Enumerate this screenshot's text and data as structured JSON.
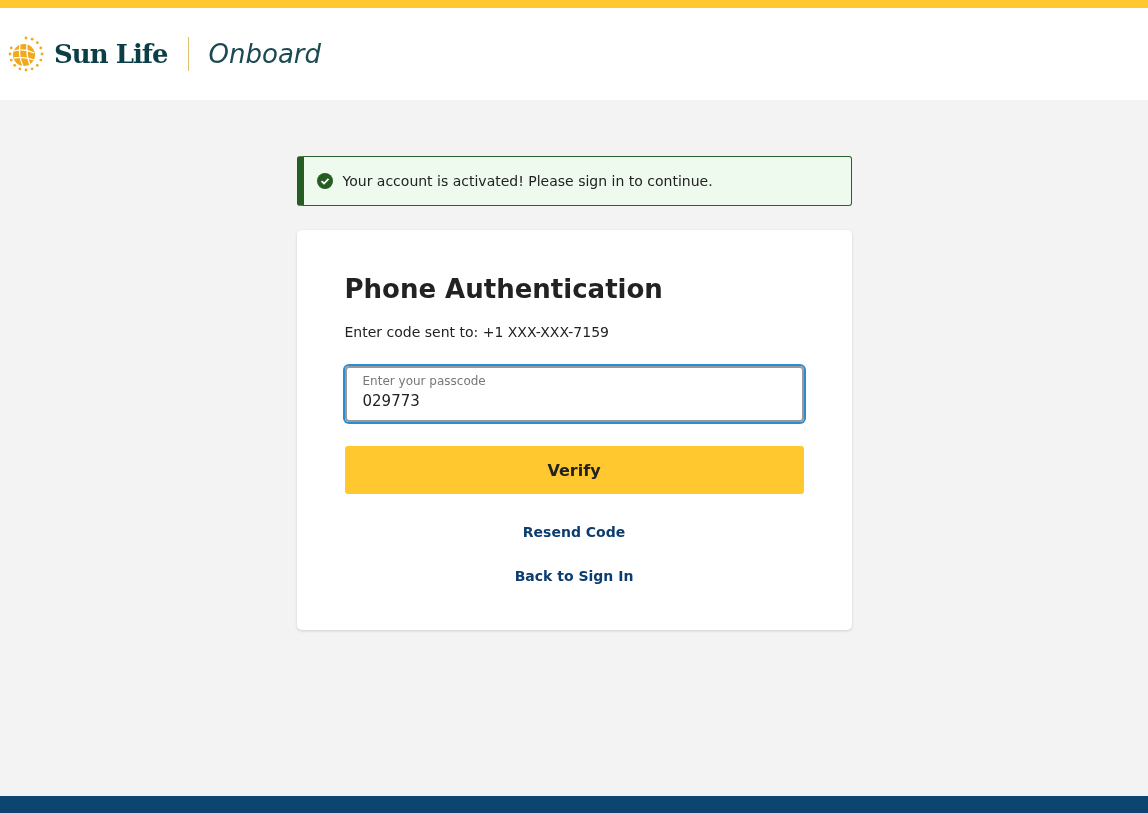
{
  "header": {
    "brand": "Sun Life",
    "product": "Onboard"
  },
  "alert": {
    "message": "Your account is activated! Please sign in to continue."
  },
  "card": {
    "title": "Phone Authentication",
    "instruction": "Enter code sent to: +1 XXX-XXX-7159",
    "passcode_field": {
      "label": "Enter your passcode",
      "value": "029773",
      "focused": true
    },
    "verify_button": "Verify",
    "links": [
      "Resend Code",
      "Back to Sign In"
    ]
  }
}
